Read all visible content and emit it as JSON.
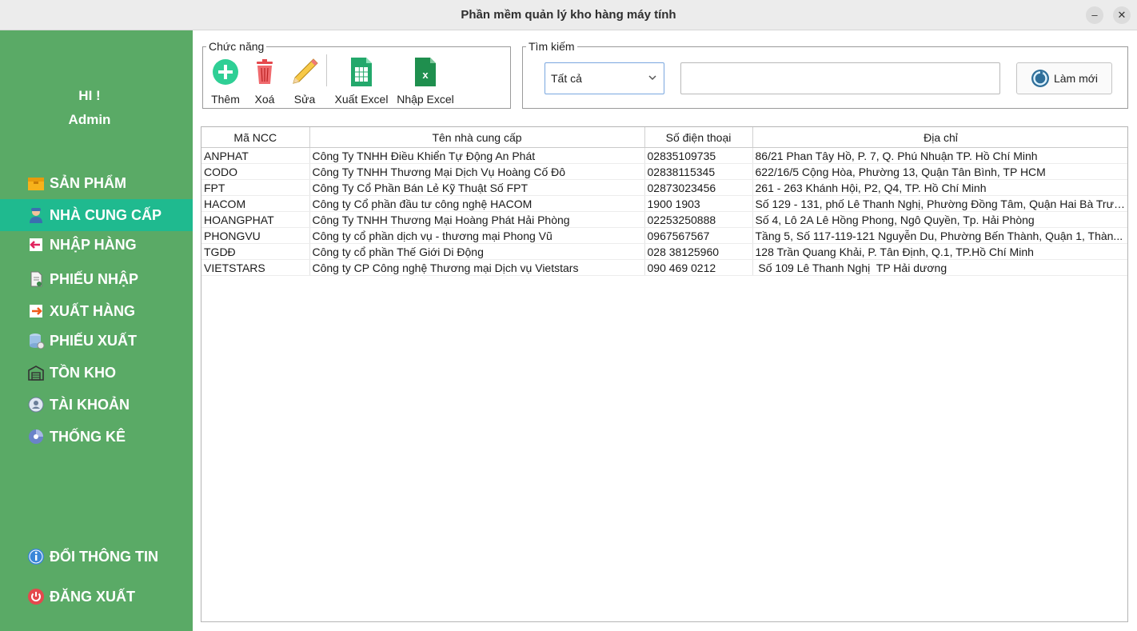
{
  "window": {
    "title": "Phần mềm quản lý kho hàng máy tính"
  },
  "sidebar": {
    "greeting": "HI !",
    "username": "Admin",
    "items": [
      {
        "label": "SẢN PHẨM",
        "icon": "box-icon"
      },
      {
        "label": "NHÀ CUNG CẤP",
        "icon": "supplier-person-icon"
      },
      {
        "label": "NHẬP HÀNG",
        "icon": "import-arrow-icon"
      },
      {
        "label": "PHIẾU NHẬP",
        "icon": "import-receipt-icon"
      },
      {
        "label": "XUẤT HÀNG",
        "icon": "export-arrow-icon"
      },
      {
        "label": "PHIẾU XUẤT",
        "icon": "export-receipt-icon"
      },
      {
        "label": "TỒN KHO",
        "icon": "warehouse-icon"
      },
      {
        "label": "TÀI KHOẢN",
        "icon": "account-icon"
      },
      {
        "label": "THỐNG KÊ",
        "icon": "statistics-icon"
      }
    ],
    "bottom_items": [
      {
        "label": "ĐỔI THÔNG TIN",
        "icon": "info-icon"
      },
      {
        "label": "ĐĂNG XUẤT",
        "icon": "power-icon"
      }
    ],
    "active_index": 1,
    "colors": {
      "background": "#5aaa66",
      "active": "#1fba8f"
    }
  },
  "toolbar": {
    "group_label": "Chức năng",
    "buttons": [
      {
        "label": "Thêm",
        "icon": "add-icon"
      },
      {
        "label": "Xoá",
        "icon": "trash-icon"
      },
      {
        "label": "Sửa",
        "icon": "pencil-icon"
      },
      {
        "label": "Xuất Excel",
        "icon": "spreadsheet-export-icon"
      },
      {
        "label": "Nhập Excel",
        "icon": "excel-import-icon"
      }
    ]
  },
  "search": {
    "group_label": "Tìm kiếm",
    "filter_selected": "Tất cả",
    "query": "",
    "refresh_label": "Làm mới"
  },
  "table": {
    "headers": [
      "Mã NCC",
      "Tên nhà cung cấp",
      "Số điện thoại",
      "Địa chỉ"
    ],
    "rows": [
      [
        "ANPHAT",
        "Công Ty TNHH Điều Khiển Tự Động An Phát",
        "02835109735",
        "86/21 Phan Tây Hồ, P. 7, Q. Phú Nhuận TP. Hồ Chí Minh"
      ],
      [
        "CODO",
        "Công Ty TNHH Thương Mại Dịch Vụ Hoàng Cố Đô",
        "02838115345",
        "622/16/5 Cộng Hòa, Phường 13, Quận Tân Bình, TP HCM"
      ],
      [
        "FPT",
        "Công Ty Cổ Phần Bán Lẻ Kỹ Thuật Số FPT",
        "02873023456",
        "261 - 263 Khánh Hội, P2, Q4, TP. Hồ Chí Minh"
      ],
      [
        "HACOM",
        "Công ty Cổ phần đầu tư công nghệ HACOM",
        "1900 1903",
        "Số 129 - 131, phố Lê Thanh Nghị, Phường Đồng Tâm, Quận Hai Bà Trưn..."
      ],
      [
        "HOANGPHAT",
        "Công Ty TNHH Thương Mại Hoàng Phát Hải Phòng",
        "02253250888",
        "Số 4, Lô 2A Lê Hồng Phong, Ngô Quyền, Tp. Hải Phòng"
      ],
      [
        "PHONGVU",
        "Công ty cổ phần dịch vụ - thương mại Phong Vũ",
        "0967567567",
        "Tầng 5, Số 117-119-121 Nguyễn Du, Phường Bến Thành, Quận 1, Thàn..."
      ],
      [
        "TGDĐ",
        "Công ty cổ phần Thế Giới Di Động",
        "028 38125960",
        "128 Trần Quang Khải, P. Tân Định, Q.1, TP.Hồ Chí Minh"
      ],
      [
        "VIETSTARS",
        "Công ty CP Công nghệ Thương mại Dịch vụ Vietstars",
        "090 469 0212",
        " Số 109 Lê Thanh Nghị  TP Hải dương"
      ]
    ]
  }
}
